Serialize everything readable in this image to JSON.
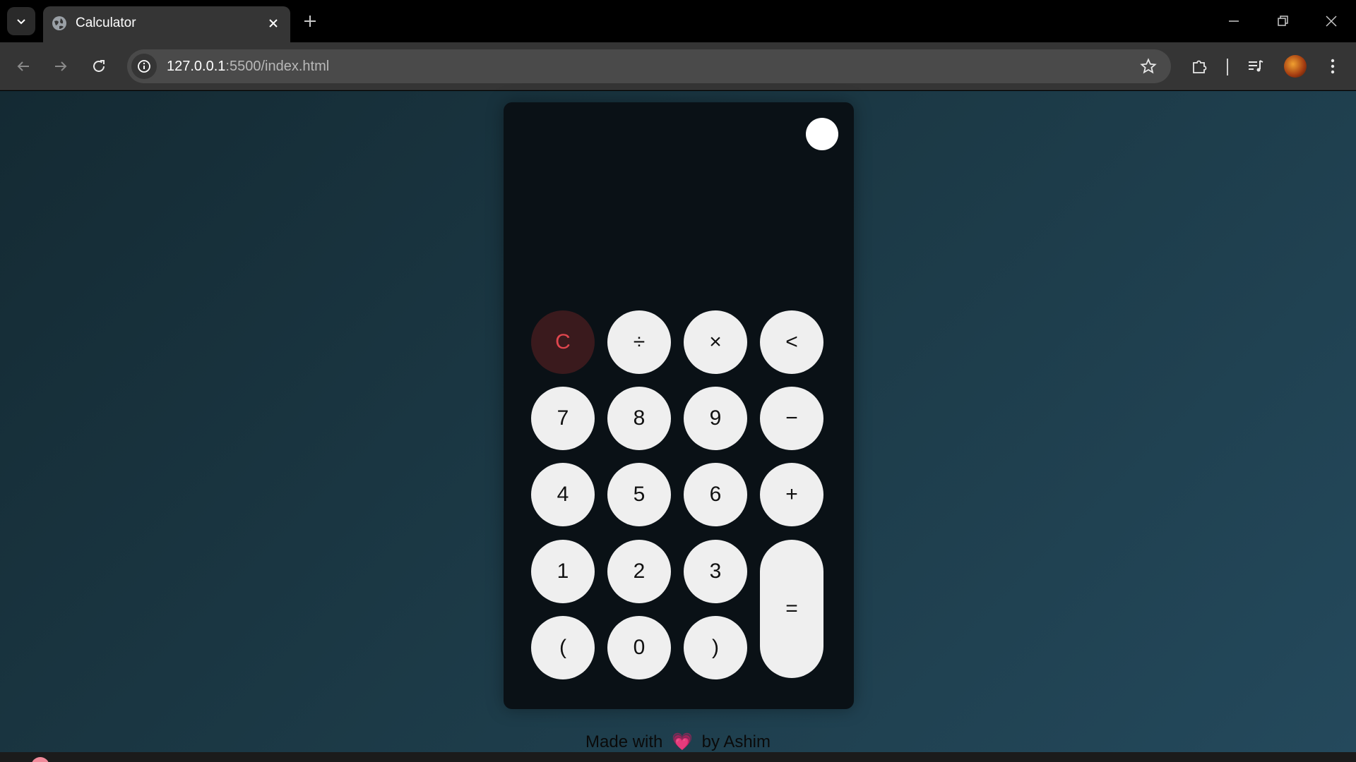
{
  "browser": {
    "tab_title": "Calculator",
    "url_host": "127.0.0.1",
    "url_rest": ":5500/index.html"
  },
  "calculator": {
    "display": "",
    "keys": [
      "C",
      "÷",
      "×",
      "<",
      "7",
      "8",
      "9",
      "−",
      "4",
      "5",
      "6",
      "+",
      "1",
      "2",
      "3",
      "=",
      "(",
      "0",
      ")"
    ]
  },
  "footer": {
    "prefix": "Made with",
    "heart": "💗",
    "suffix": "by Ashim"
  },
  "colors": {
    "clear_key_text": "#e0464e",
    "clear_key_bg": "#3a1a1d",
    "key_bg": "#efefef",
    "calc_bg": "#0a1116"
  }
}
